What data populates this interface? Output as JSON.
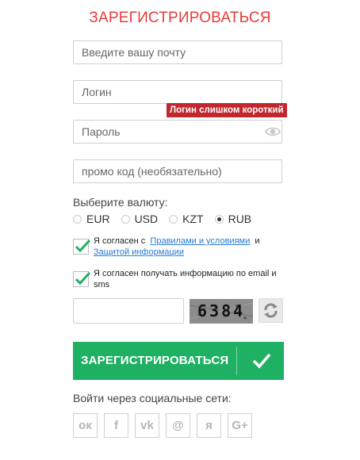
{
  "title": "ЗАРЕГИСТРИРОВАТЬСЯ",
  "email": {
    "placeholder": "Введите вашу почту"
  },
  "login": {
    "placeholder": "Логин",
    "error": "Логин слишком короткий"
  },
  "password": {
    "placeholder": "Пароль"
  },
  "promo": {
    "placeholder": "промо код (необязательно)"
  },
  "currency": {
    "label": "Выберите валюту:",
    "options": [
      "EUR",
      "USD",
      "KZT",
      "RUB"
    ],
    "selected": "RUB"
  },
  "agree": {
    "prefix": "Я согласен с",
    "rules_link": "Правилами и условиями",
    "and": "и",
    "privacy_link": "Защитой информации",
    "checked": true
  },
  "newsletter": {
    "text": "Я согласен получать информацию по email и sms",
    "checked": true
  },
  "captcha": {
    "code": "6384"
  },
  "register_button": "ЗАРЕГИСТРИРОВАТЬСЯ",
  "social": {
    "label": "Войти через социальные сети:",
    "networks": [
      {
        "name": "odnoklassniki",
        "glyph": "ок"
      },
      {
        "name": "facebook",
        "glyph": "f"
      },
      {
        "name": "vkontakte",
        "glyph": "vk"
      },
      {
        "name": "mailru",
        "glyph": "@"
      },
      {
        "name": "yandex",
        "glyph": "я"
      },
      {
        "name": "googleplus",
        "glyph": "G+"
      }
    ]
  },
  "colors": {
    "accent_red": "#e83b3b",
    "error_bg": "#c1272d",
    "primary_green": "#1fb163",
    "link": "#2a7ad0"
  }
}
